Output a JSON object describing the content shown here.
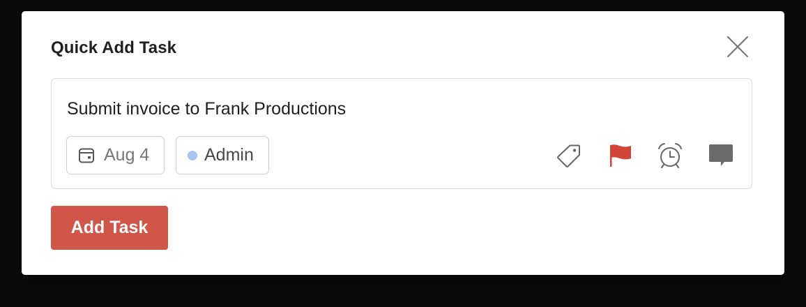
{
  "modal": {
    "title": "Quick Add Task",
    "close_icon": "close-icon"
  },
  "task": {
    "text": "Submit invoice to Frank Productions"
  },
  "due_date": {
    "icon": "calendar-icon",
    "label": "Aug 4"
  },
  "project": {
    "label": "Admin",
    "color": "#a9c4ee"
  },
  "tools": {
    "label_icon": "tag-icon",
    "priority_icon": "flag-icon",
    "priority_color": "#d1453b",
    "reminder_icon": "alarm-clock-icon",
    "comment_icon": "comment-icon"
  },
  "actions": {
    "add_label": "Add Task",
    "add_color": "#d1564a"
  }
}
